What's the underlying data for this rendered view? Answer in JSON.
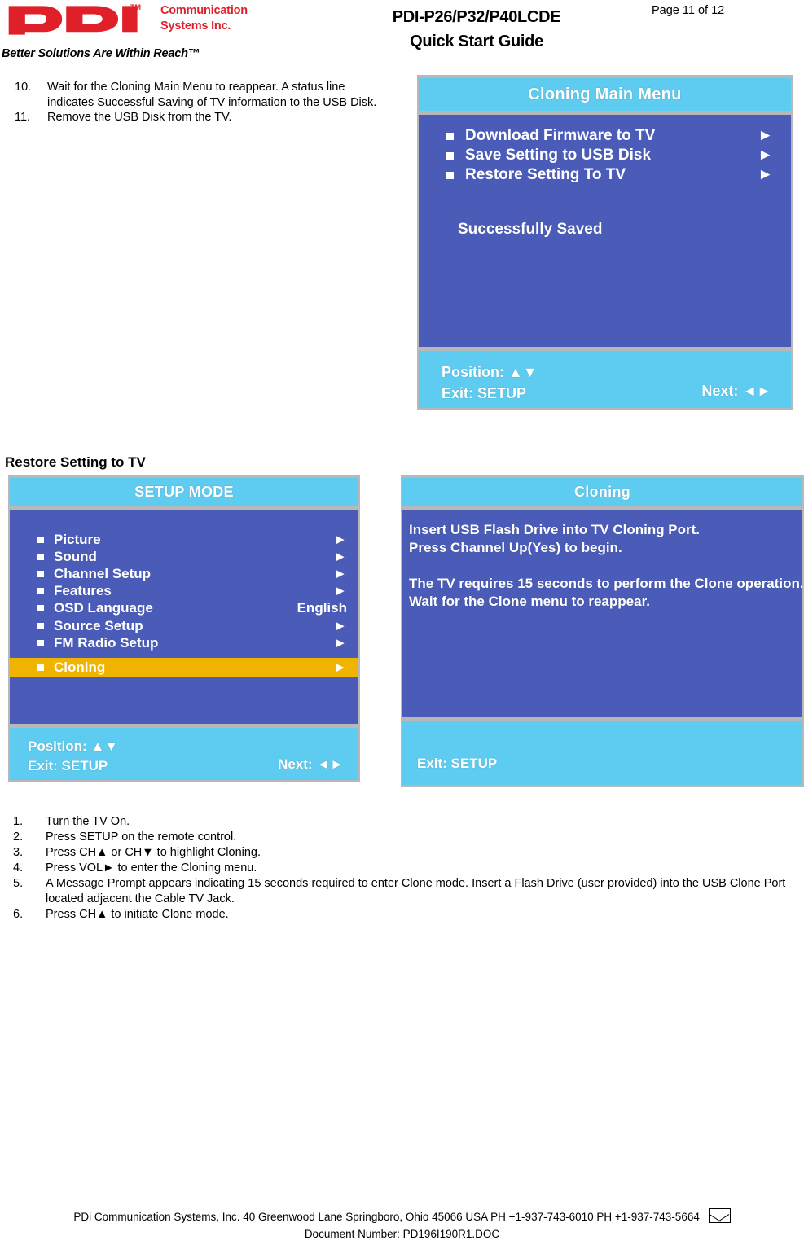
{
  "header": {
    "logo_wordmark": "PDi",
    "logo_tm": "TM",
    "company_line1": "Communication",
    "company_line2": "Systems Inc.",
    "tagline": "Better Solutions Are Within Reach™",
    "doc_title_line1": "PDI-P26/P32/P40LCDE",
    "doc_title_line2": "Quick Start Guide",
    "page_number": "Page 11 of 12"
  },
  "steps_top": [
    {
      "num": "10.",
      "text": "Wait for the Cloning Main Menu to reappear.  A status line indicates Successful Saving of TV information to the USB Disk."
    },
    {
      "num": "11.",
      "text": "Remove the USB Disk from the TV."
    }
  ],
  "osd_cloning_main": {
    "title": "Cloning Main Menu",
    "rows": [
      {
        "label": "Download Firmware to TV",
        "value": "►"
      },
      {
        "label": "Save Setting to USB Disk",
        "value": "►"
      },
      {
        "label": "Restore Setting To TV",
        "value": "►"
      }
    ],
    "status": "Successfully Saved",
    "footer_line1": "Position: ▲▼",
    "footer_line2": "Exit: SETUP",
    "footer_right": "Next: ◄►"
  },
  "section_heading": "Restore Setting to TV",
  "osd_setup_mode": {
    "title": "SETUP MODE",
    "rows": [
      {
        "label": "Picture",
        "value": "►"
      },
      {
        "label": "Sound",
        "value": "►"
      },
      {
        "label": "Channel Setup",
        "value": "►"
      },
      {
        "label": "Features",
        "value": "►"
      },
      {
        "label": "OSD Language",
        "value": "English"
      },
      {
        "label": "Source Setup",
        "value": "►"
      },
      {
        "label": "FM Radio Setup",
        "value": "►"
      }
    ],
    "highlighted_row": {
      "label": "Cloning",
      "value": "►"
    },
    "footer_line1": "Position: ▲▼",
    "footer_line2": "Exit: SETUP",
    "footer_right": "Next: ◄►",
    "highlight_color": "#f0b400"
  },
  "osd_cloning": {
    "title": "Cloning",
    "message_line1": "Insert USB Flash Drive into TV Cloning Port.",
    "message_line2": "Press Channel Up(Yes) to begin.",
    "message_line3": "The TV requires 15 seconds to perform the Clone operation.",
    "message_line4": "Wait for the Clone menu to reappear.",
    "footer_line": "Exit: SETUP"
  },
  "steps_bottom": [
    {
      "num": "1.",
      "text": "Turn the TV On."
    },
    {
      "num": "2.",
      "text": "Press SETUP on the remote control."
    },
    {
      "num": "3.",
      "text": "Press CH▲ or CH▼ to highlight Cloning."
    },
    {
      "num": "4.",
      "text": "Press VOL► to enter the Cloning menu."
    },
    {
      "num": "5.",
      "text": "A Message Prompt appears indicating 15 seconds required to enter Clone mode.  Insert a Flash Drive (user provided) into the USB Clone Port located adjacent the Cable TV Jack."
    },
    {
      "num": "6.",
      "text": "Press CH▲ to initiate Clone mode."
    }
  ],
  "footer": {
    "line1": "PDi Communication Systems, Inc.   40 Greenwood Lane   Springboro, Ohio 45066 USA   PH +1-937-743-6010 PH +1-937-743-5664",
    "line2": "Document Number:  PD196I190R1.DOC",
    "envelope_icon": "envelope-icon"
  },
  "colors": {
    "brand_red": "#e02029",
    "osd_title_blue": "#5ecbf0",
    "osd_body_blue": "#4a5cb8",
    "osd_bezel_gray": "#b8b8b8",
    "highlight_gold": "#f0b400"
  }
}
